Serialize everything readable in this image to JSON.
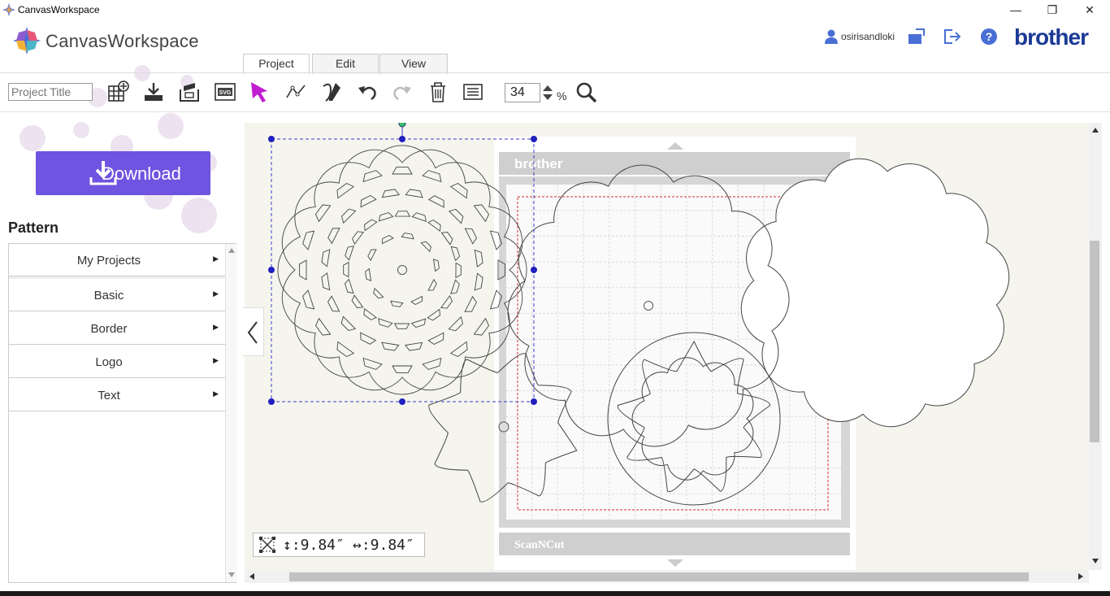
{
  "window": {
    "title": "CanvasWorkspace",
    "minimize": "—",
    "restore": "❐",
    "close": "✕"
  },
  "header": {
    "app_name": "CanvasWorkspace",
    "username": "osirisandloki",
    "brand": "brother"
  },
  "tabs": [
    {
      "label": "Project"
    },
    {
      "label": "Edit"
    },
    {
      "label": "View"
    }
  ],
  "toolbar": {
    "project_title_placeholder": "Project Title",
    "zoom_value": "34",
    "zoom_unit": "%"
  },
  "left_panel": {
    "download_label": "Download",
    "pattern_heading": "Pattern",
    "items": [
      {
        "label": "My Projects"
      },
      {
        "label": "Basic"
      },
      {
        "label": "Border"
      },
      {
        "label": "Logo"
      },
      {
        "label": "Text"
      }
    ]
  },
  "canvas": {
    "mat_brand": "brother",
    "mat_product": "ScanNCut",
    "size_height": "↕:9.84″",
    "size_width": "↔:9.84″"
  },
  "colors": {
    "accent": "#6e54e0",
    "brand_blue": "#1b3a96",
    "selection": "#2a2acc",
    "icon_blue": "#4a6fd4"
  }
}
